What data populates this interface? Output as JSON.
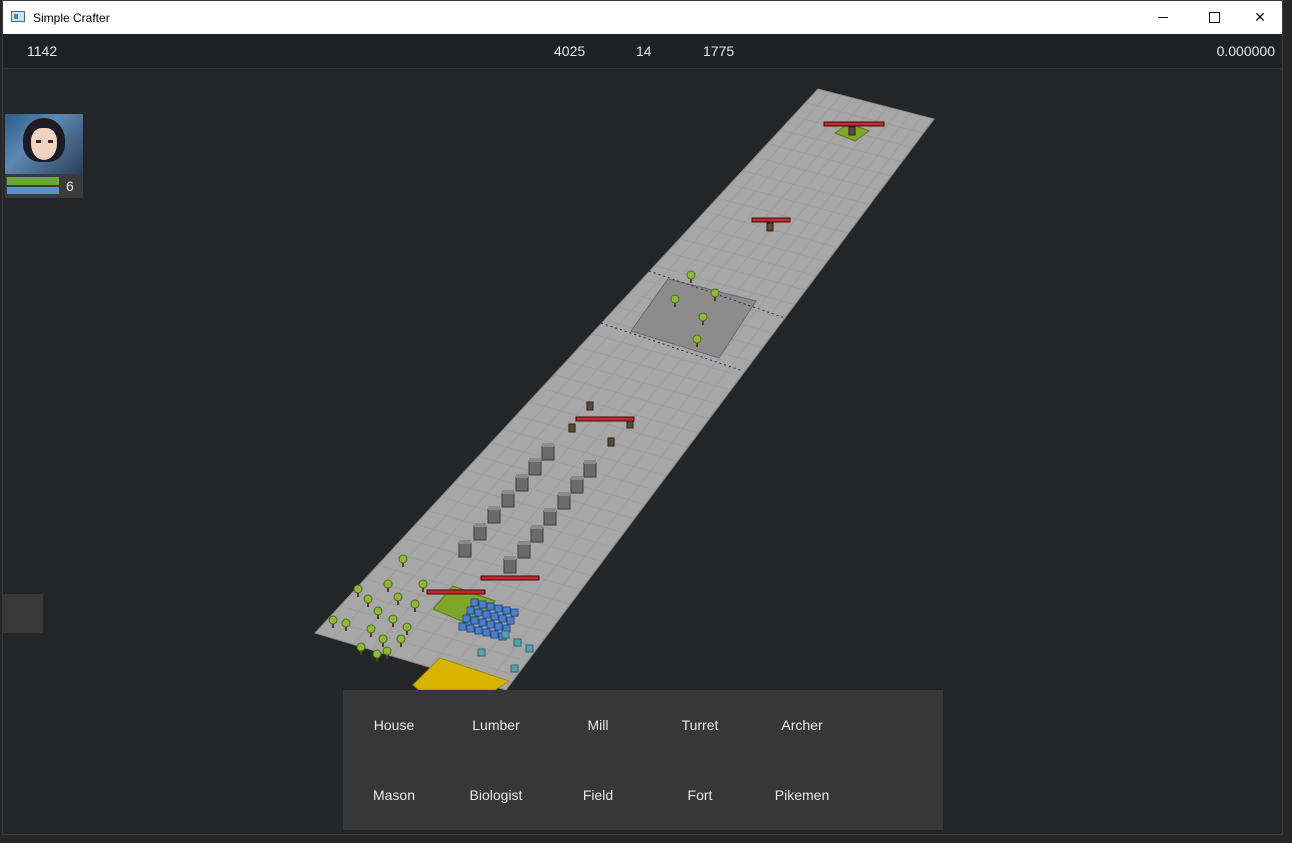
{
  "window": {
    "title": "Simple Crafter"
  },
  "stats": {
    "left": "1142",
    "a": "4025",
    "b": "14",
    "c": "1775",
    "right": "0.000000"
  },
  "player": {
    "unit_count": "6"
  },
  "build_menu": {
    "items": [
      {
        "label": "House"
      },
      {
        "label": "Lumber"
      },
      {
        "label": "Mill"
      },
      {
        "label": "Turret"
      },
      {
        "label": "Archer"
      },
      {
        "label": "Mason"
      },
      {
        "label": "Biologist"
      },
      {
        "label": "Field"
      },
      {
        "label": "Fort"
      },
      {
        "label": "Pikemen"
      }
    ]
  },
  "colors": {
    "ground": "#a7a7a7",
    "enemy_zone": "#8b8b8b",
    "field": "#d6b400",
    "base": "#7fa52a",
    "health_bar": "#c8282d",
    "menu_bg": "#373737"
  }
}
